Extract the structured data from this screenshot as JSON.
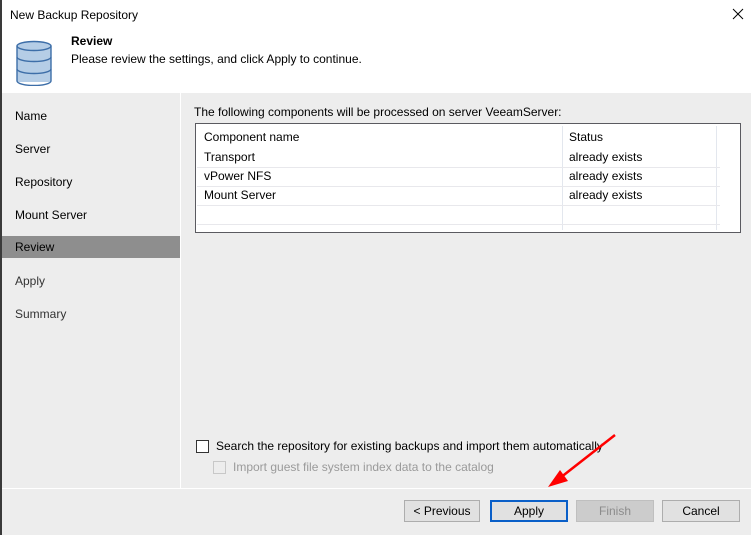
{
  "window": {
    "title": "New Backup Repository",
    "close_icon": "close-icon"
  },
  "header": {
    "icon": "database-icon",
    "step_title": "Review",
    "step_description": "Please review the settings, and click Apply to continue."
  },
  "sidebar": {
    "items": [
      {
        "label": "Name",
        "state": "done"
      },
      {
        "label": "Server",
        "state": "done"
      },
      {
        "label": "Repository",
        "state": "done"
      },
      {
        "label": "Mount Server",
        "state": "done"
      },
      {
        "label": "Review",
        "state": "active"
      },
      {
        "label": "Apply",
        "state": "pending"
      },
      {
        "label": "Summary",
        "state": "pending"
      }
    ]
  },
  "main": {
    "intro": "The following components will be processed on server VeeamServer:",
    "table": {
      "columns": [
        "Component name",
        "Status"
      ],
      "rows": [
        [
          "Transport",
          "already exists"
        ],
        [
          "vPower NFS",
          "already exists"
        ],
        [
          "Mount Server",
          "already exists"
        ]
      ]
    },
    "options": {
      "search_backups": {
        "label": "Search the repository for existing backups and import them automatically",
        "checked": false,
        "enabled": true
      },
      "import_index": {
        "label": "Import guest file system index data to the catalog",
        "checked": false,
        "enabled": false
      }
    }
  },
  "footer": {
    "previous_label": "< Previous",
    "apply_label": "Apply",
    "finish_label": "Finish",
    "cancel_label": "Cancel"
  },
  "annotation": {
    "type": "red-arrow",
    "color": "#ff0000",
    "points_to": "Apply"
  },
  "colors": {
    "active_step": "#8e8e8e",
    "primary_button_border": "#0a5fc8",
    "dialog_background": "#ededed"
  }
}
